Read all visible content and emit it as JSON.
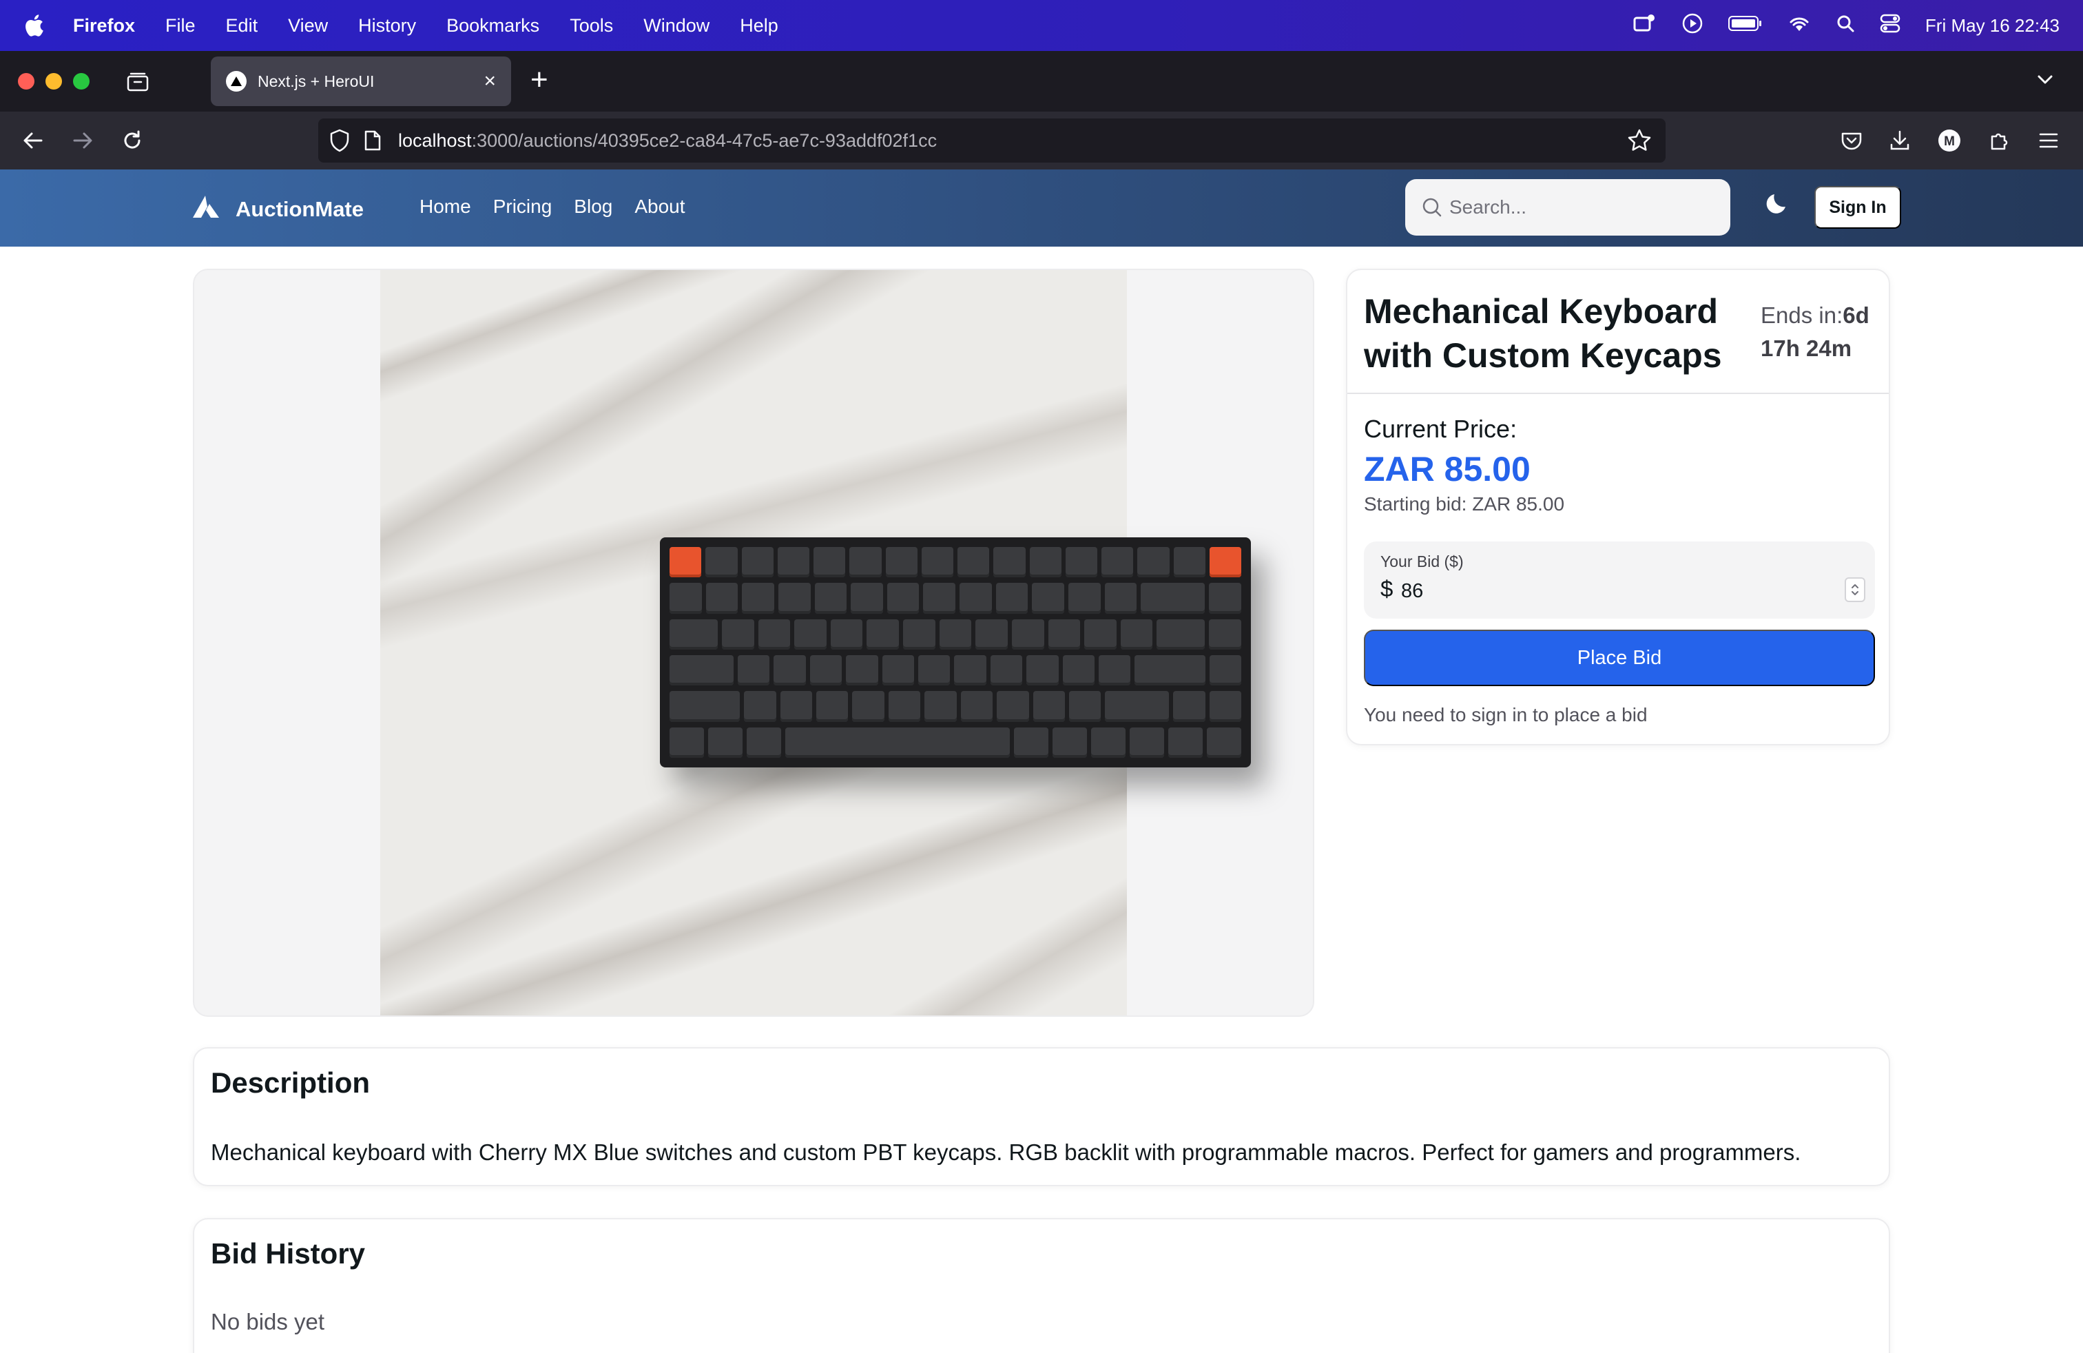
{
  "os_menubar": {
    "app_name": "Firefox",
    "items": [
      "File",
      "Edit",
      "View",
      "History",
      "Bookmarks",
      "Tools",
      "Window",
      "Help"
    ],
    "clock": "Fri May 16  22:43"
  },
  "browser": {
    "tab_title": "Next.js + HeroUI",
    "url_host": "localhost",
    "url_path": ":3000/auctions/40395ce2-ca84-47c5-ae7c-93addf02f1cc",
    "profile_initial": "M"
  },
  "site": {
    "brand": "AuctionMate",
    "nav": [
      "Home",
      "Pricing",
      "Blog",
      "About"
    ],
    "search_placeholder": "Search...",
    "signin_label": "Sign In"
  },
  "auction": {
    "title": "Mechanical Keyboard with Custom Keycaps",
    "ends_label": "Ends in:",
    "ends_value_days": "6d",
    "ends_value_rest": "17h 24m",
    "current_price_label": "Current Price:",
    "current_price": "ZAR 85.00",
    "starting_bid": "Starting bid: ZAR 85.00",
    "bid_input_label": "Your Bid ($)",
    "bid_currency_symbol": "$",
    "bid_value": "86",
    "place_bid_label": "Place Bid",
    "signin_note": "You need to sign in to place a bid"
  },
  "description": {
    "heading": "Description",
    "text": "Mechanical keyboard with Cherry MX Blue switches and custom PBT keycaps. RGB backlit with programmable macros. Perfect for gamers and programmers."
  },
  "bid_history": {
    "heading": "Bid History",
    "empty_text": "No bids yet"
  },
  "colors": {
    "accent": "#2563eb",
    "header_gradient_start": "#3b6aa8",
    "header_gradient_end": "#243859"
  }
}
